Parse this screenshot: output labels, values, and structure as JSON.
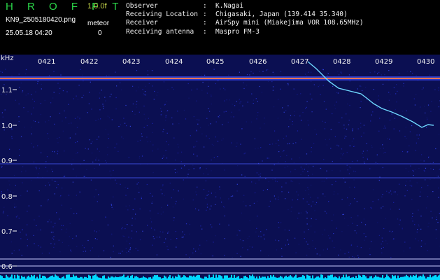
{
  "header": {
    "app_name": "H R O F F T",
    "version": "1.0.0f",
    "filename": "KN9_2505180420.png",
    "meteor_label": "meteor",
    "datetime": "25.05.18 04:20",
    "meteor_count": "0",
    "info": [
      {
        "key": "Observer",
        "sep": ":",
        "value": "K.Nagai"
      },
      {
        "key": "Receiving Location",
        "sep": ":",
        "value": "Chigasaki, Japan (139.414 35.340)"
      },
      {
        "key": "Receiver",
        "sep": ":",
        "value": "AirSpy mini (Miakejima VOR 108.65MHz)"
      },
      {
        "key": "Receiving antenna",
        "sep": ":",
        "value": "Maspro FM-3"
      }
    ]
  },
  "plot": {
    "y_unit": "kHz",
    "y_ticks": [
      "1.1",
      "1.0",
      "0.9",
      "0.8",
      "0.7",
      "0.6"
    ],
    "time_ticks": [
      "0421",
      "0422",
      "0423",
      "0424",
      "0425",
      "0426",
      "0427",
      "0428",
      "0429",
      "0430"
    ],
    "colors": {
      "background": "#0b0f52",
      "carrier": "#e0a03a",
      "trace": "#6fd8ff",
      "noise_floor": "#00d8ff",
      "ref_line": "#c8c8ff"
    }
  }
}
